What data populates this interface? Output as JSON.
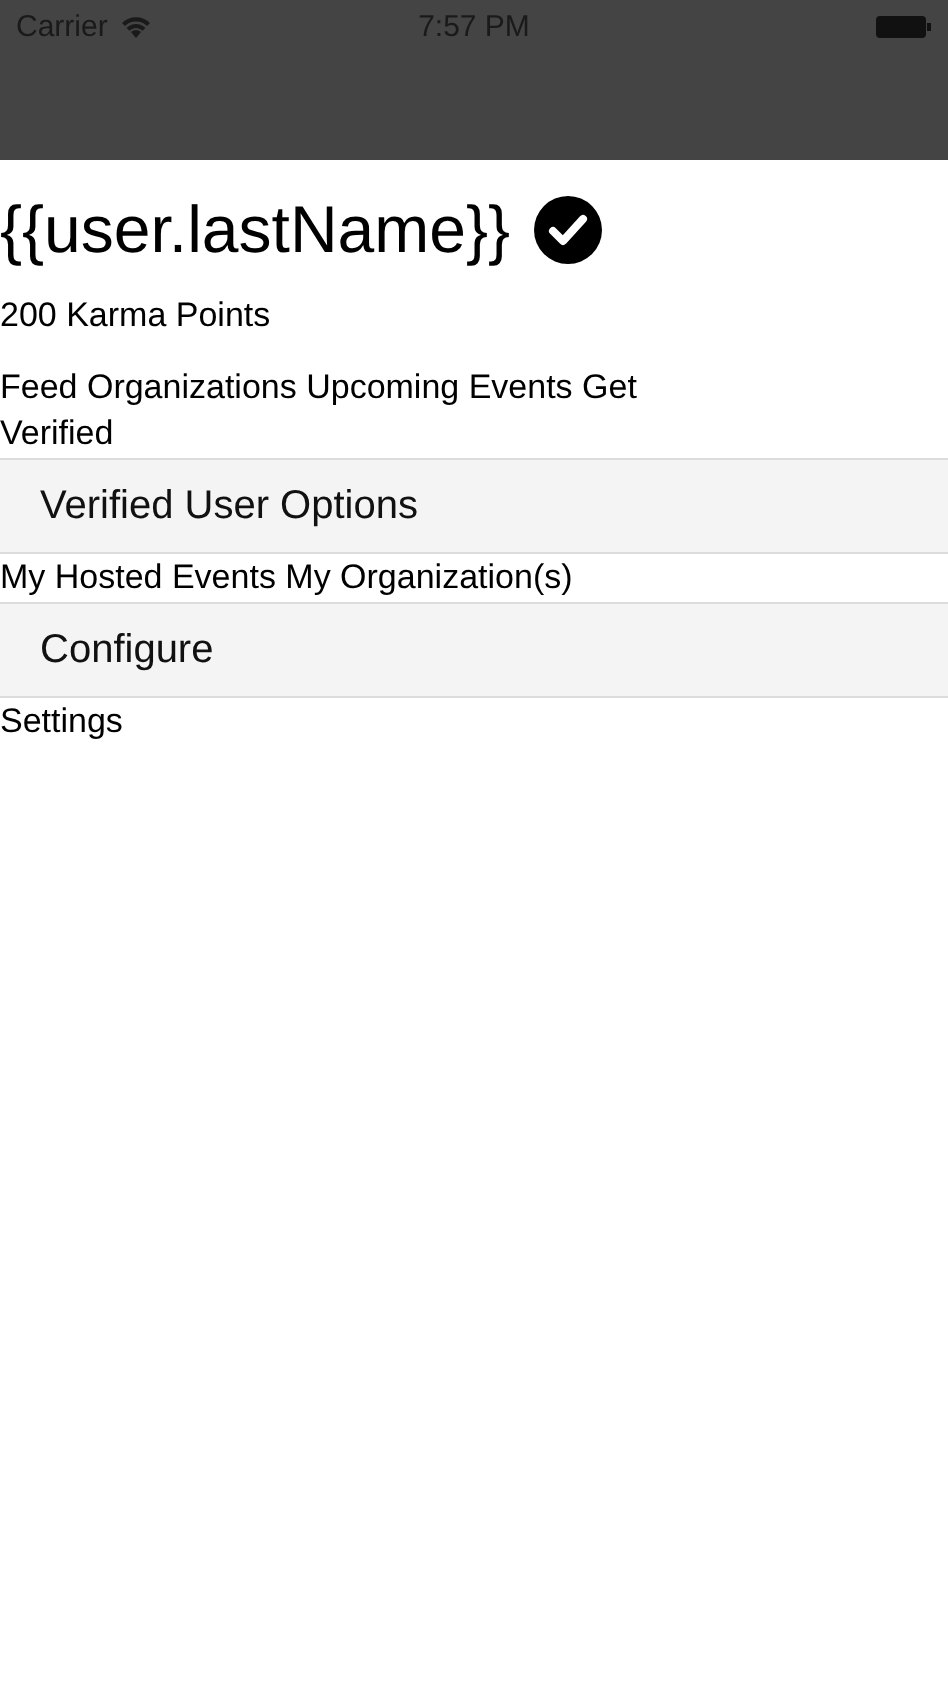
{
  "status_bar": {
    "carrier": "Carrier",
    "time": "7:57 PM"
  },
  "profile": {
    "last_name": "{{user.lastName}}",
    "verified": true,
    "karma": "200 Karma Points"
  },
  "nav_links": "Feed Organizations Upcoming Events Get Verified",
  "sections": [
    {
      "header": "Verified User Options",
      "content": "My Hosted Events My Organization(s)"
    },
    {
      "header": "Configure",
      "content": "Settings"
    }
  ]
}
